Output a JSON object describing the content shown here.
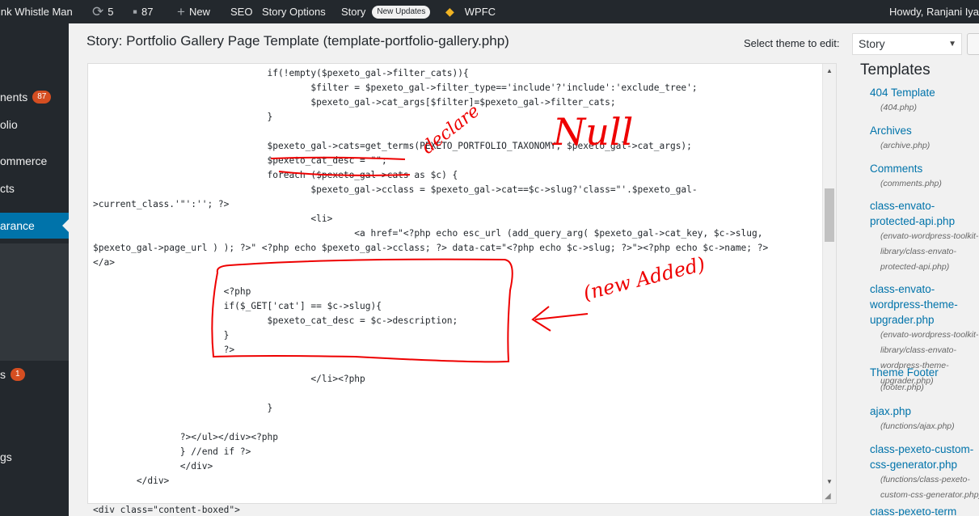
{
  "adminbar": {
    "site_name": "ink Whistle Man",
    "updates_count": "5",
    "comments_count": "87",
    "new_label": "New",
    "seo_label": "SEO",
    "story_options_label": "Story Options",
    "story_label": "Story",
    "new_updates_badge": "New Updates",
    "wpfc_label": "WPFC",
    "howdy": "Howdy, Ranjani Iya"
  },
  "sidebar": {
    "items": [
      {
        "label": "nents",
        "count": "87"
      },
      {
        "label": "olio"
      },
      {
        "label": "ommerce"
      },
      {
        "label": "cts"
      },
      {
        "label": "arance"
      },
      {
        "label": "s",
        "count": "1"
      },
      {
        "label": "gs"
      }
    ]
  },
  "page_title": "Story: Portfolio Gallery Page Template (template-portfolio-gallery.php)",
  "theme_select": {
    "label": "Select theme to edit:",
    "value": "Story"
  },
  "code_lines": [
    "                                if(!empty($pexeto_gal->filter_cats)){",
    "                                        $filter = $pexeto_gal->filter_type=='include'?'include':'exclude_tree';",
    "                                        $pexeto_gal->cat_args[$filter]=$pexeto_gal->filter_cats;",
    "                                }",
    "",
    "                                $pexeto_gal->cats=get_terms(PEXETO_PORTFOLIO_TAXONOMY, $pexeto_gal->cat_args);",
    "                                $pexeto_cat_desc = \"\";",
    "                                foreach ($pexeto_gal->cats as $c) {",
    "                                        $pexeto_gal->cclass = $pexeto_gal->cat==$c->slug?'class=\"'.$pexeto_gal-",
    ">current_class.'\"':''; ?>",
    "                                        <li>",
    "                                                <a href=\"<?php echo esc_url (add_query_arg( $pexeto_gal->cat_key, $c->slug,",
    "$pexeto_gal->page_url ) ); ?>\" <?php echo $pexeto_gal->cclass; ?> data-cat=\"<?php echo $c->slug; ?>\"><?php echo $c->name; ?>",
    "</a>",
    "",
    "                        <?php",
    "                        if($_GET['cat'] == $c->slug){",
    "                                $pexeto_cat_desc = $c->description;",
    "                        }",
    "                        ?>",
    "",
    "                                        </li><?php",
    "",
    "                                }",
    "",
    "                ?></ul></div><?php",
    "                } //end if ?>",
    "                </div>",
    "        </div>",
    "",
    "<div class=\"content-boxed\">"
  ],
  "annotations": {
    "declare_text": "declare",
    "null_text": "Null",
    "new_added_text": "(new Added)",
    "color": "#ff0000"
  },
  "templates": {
    "heading": "Templates",
    "items": [
      {
        "name": "404 Template",
        "file": "(404.php)"
      },
      {
        "name": "Archives",
        "file": "(archive.php)"
      },
      {
        "name": "Comments",
        "file": "(comments.php)"
      },
      {
        "name": "class-envato-protected-api.php",
        "file": "(envato-wordpress-toolkit-library/class-envato-protected-api.php)"
      },
      {
        "name": "class-envato-wordpress-theme-upgrader.php",
        "file": "(envato-wordpress-toolkit-library/class-envato-wordpress-theme-upgrader.php)"
      },
      {
        "name": "Theme Footer",
        "file": "(footer.php)"
      },
      {
        "name": "ajax.php",
        "file": "(functions/ajax.php)"
      },
      {
        "name": "class-pexeto-custom-css-generator.php",
        "file": "(functions/class-pexeto-custom-css-generator.php)"
      },
      {
        "name": "class-pexeto-term"
      }
    ]
  }
}
